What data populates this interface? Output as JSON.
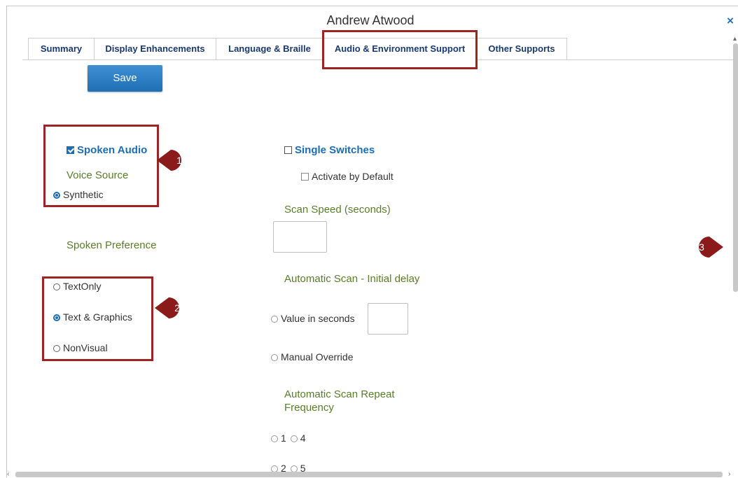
{
  "window": {
    "title": "Andrew Atwood",
    "close_glyph": "×"
  },
  "tabs": [
    {
      "label": "Summary"
    },
    {
      "label": "Display Enhancements"
    },
    {
      "label": "Language & Braille"
    },
    {
      "label": "Audio & Environment Support"
    },
    {
      "label": "Other Supports"
    }
  ],
  "save_label": "Save",
  "spoken_audio": {
    "label": "Spoken Audio",
    "checked": true
  },
  "voice_source": {
    "heading": "Voice Source",
    "option": "Synthetic",
    "selected": true
  },
  "spoken_preference": {
    "heading": "Spoken Preference",
    "options": [
      {
        "label": "TextOnly",
        "selected": false
      },
      {
        "label": "Text & Graphics",
        "selected": true
      },
      {
        "label": "NonVisual",
        "selected": false
      }
    ]
  },
  "single_switches": {
    "label": "Single Switches",
    "checked": false
  },
  "activate_by_default": {
    "label": "Activate by Default",
    "checked": false
  },
  "scan_speed": {
    "heading": "Scan Speed (seconds)",
    "value": ""
  },
  "initial_delay": {
    "heading": "Automatic Scan - Initial delay",
    "value_option": "Value in seconds",
    "value": "",
    "manual_option": "Manual Override"
  },
  "repeat_frequency": {
    "heading_line1": "Automatic Scan Repeat",
    "heading_line2": "Frequency",
    "row1": [
      "1",
      "4"
    ],
    "row2": [
      "2",
      "5"
    ]
  },
  "callouts": [
    "1",
    "2",
    "3"
  ],
  "colors": {
    "highlight": "#9c2424",
    "callout": "#8b1a1a",
    "accent": "#1d6db5",
    "label_green": "#5a7d2a"
  }
}
